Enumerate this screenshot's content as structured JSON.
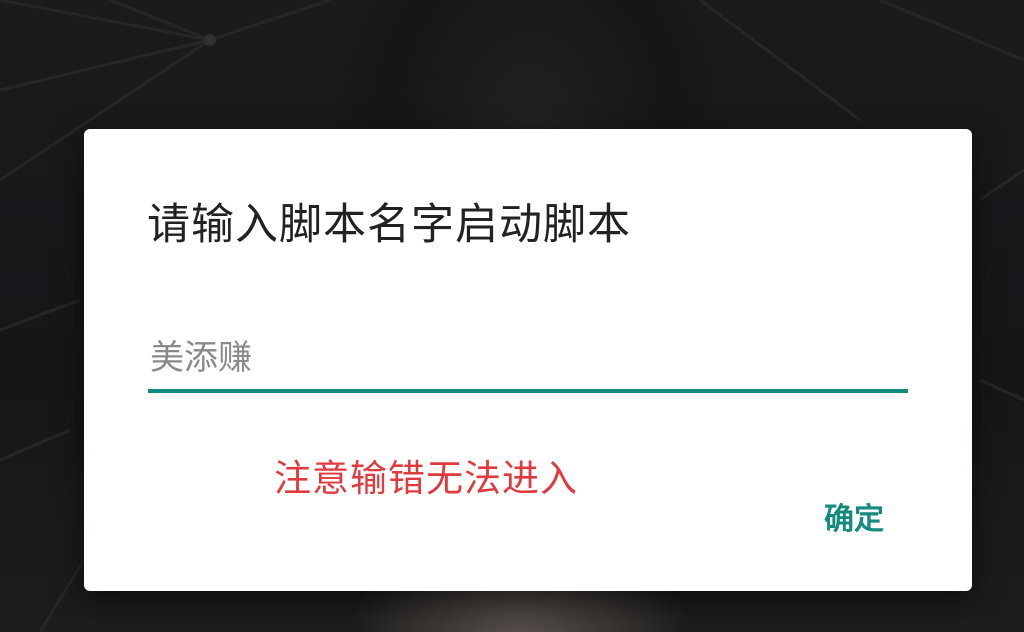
{
  "dialog": {
    "title": "请输入脚本名字启动脚本",
    "input": {
      "value": "",
      "placeholder": "美添赚"
    },
    "warning_text": "注意输错无法进入",
    "confirm_label": "确定"
  },
  "colors": {
    "accent": "#158a7e",
    "warning": "#e03a3f",
    "title": "#222222",
    "placeholder": "#8a8a8a"
  }
}
